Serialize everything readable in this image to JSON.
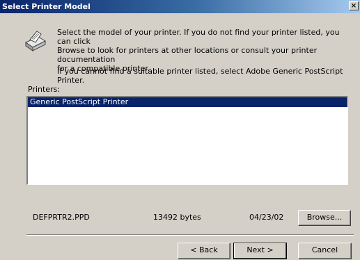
{
  "window": {
    "title": "Select Printer Model",
    "close_glyph": "×"
  },
  "intro": {
    "line1": "Select the model of your printer. If you do not find your printer listed, you can click",
    "line2": "Browse to look for printers at other locations or consult your printer documentation",
    "line3": "for a compatible printer.",
    "line4": "If you cannot find a suitable printer listed, select Adobe Generic PostScript Printer."
  },
  "printers": {
    "label": "Printers:",
    "items": [
      "Generic PostScript Printer"
    ],
    "selected_index": 0
  },
  "file_info": {
    "name": "DEFPRTR2.PPD",
    "size": "13492 bytes",
    "date": "04/23/02"
  },
  "buttons": {
    "browse": "Browse...",
    "back": "< Back",
    "next": "Next >",
    "cancel": "Cancel"
  },
  "colors": {
    "titlebar_start": "#0a246a",
    "face": "#d4d0c8",
    "selection": "#0a246a"
  },
  "icons": {
    "printer": "printer-icon",
    "close": "close-icon"
  }
}
